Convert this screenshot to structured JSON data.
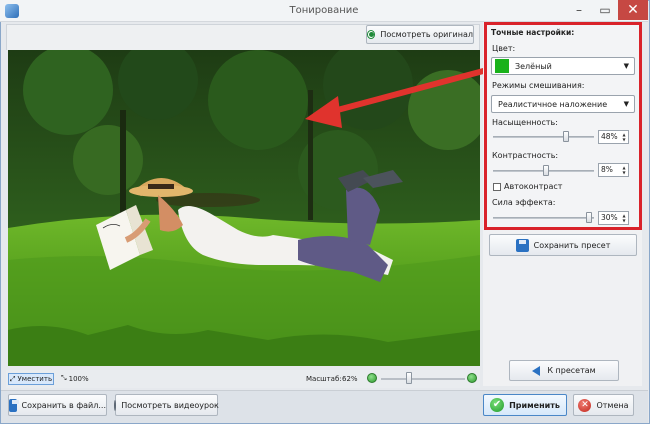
{
  "window": {
    "title": "Тонирование"
  },
  "toolbar": {
    "view_original_label": "Посмотреть оригинал"
  },
  "settings": {
    "section_title": "Точные настройки:",
    "color_label": "Цвет:",
    "color_value": "Зелёный",
    "color_swatch": "#19b21b",
    "blend_label": "Режимы смешивания:",
    "blend_value": "Реалистичное наложение",
    "saturation_label": "Насыщенность:",
    "saturation_value": "48%",
    "contrast_label": "Контрастность:",
    "contrast_value": "8%",
    "autocontrast_label": "Автоконтраст",
    "effect_label": "Сила эффекта:",
    "effect_value": "30%"
  },
  "buttons": {
    "save_preset": "Сохранить пресет",
    "to_presets": "К пресетам",
    "save_file": "Сохранить в файл...",
    "video_tutorial": "Посмотреть видеоурок",
    "apply": "Применить",
    "cancel": "Отмена"
  },
  "status": {
    "fit_label": "Уместить",
    "zoom_100": "100%",
    "scale_label": "Масштаб:",
    "scale_value": "62%"
  },
  "accent": {
    "highlight_border": "#d9222a",
    "arrow": "#e0332d"
  }
}
